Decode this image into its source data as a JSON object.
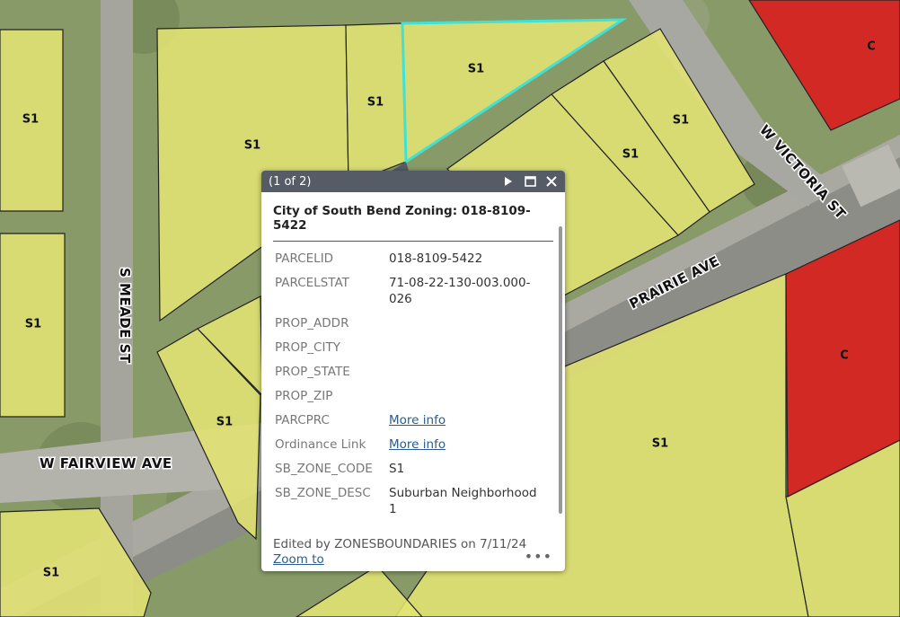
{
  "map": {
    "streets": [
      "W VICTORIA ST",
      "PRAIRIE AVE",
      "S MEADE ST",
      "W FAIRVIEW AVE"
    ],
    "zone_labels": [
      "S1",
      "S1",
      "S1",
      "S1",
      "S1",
      "S1",
      "S1",
      "S1",
      "S1",
      "S1",
      "S1",
      "S1",
      "C",
      "C"
    ],
    "colors": {
      "residential": "#e2e472",
      "commercial": "#d91f1f",
      "selected_outline": "#3ee3d6",
      "parcel_line": "#222222"
    }
  },
  "popup": {
    "count": "(1 of 2)",
    "title": "City of South Bend Zoning: 018-8109-5422",
    "fields": [
      {
        "key": "PARCELID",
        "value": "018-8109-5422"
      },
      {
        "key": "PARCELSTAT",
        "value": "71-08-22-130-003.000-026"
      },
      {
        "key": "PROP_ADDR",
        "value": ""
      },
      {
        "key": "PROP_CITY",
        "value": ""
      },
      {
        "key": "PROP_STATE",
        "value": ""
      },
      {
        "key": "PROP_ZIP",
        "value": ""
      },
      {
        "key": "PARCPRC",
        "link": "More info"
      },
      {
        "key": "Ordinance Link",
        "link": "More info"
      },
      {
        "key": "SB_ZONE_CODE",
        "value": "S1"
      },
      {
        "key": "SB_ZONE_DESC",
        "value": "Suburban Neighborhood 1"
      }
    ],
    "edited": "Edited by ZONESBOUNDARIES on 7/11/24",
    "zoom_to": "Zoom to",
    "more": "•••",
    "icons": [
      "next-arrow-icon",
      "maximize-icon",
      "close-icon"
    ]
  }
}
